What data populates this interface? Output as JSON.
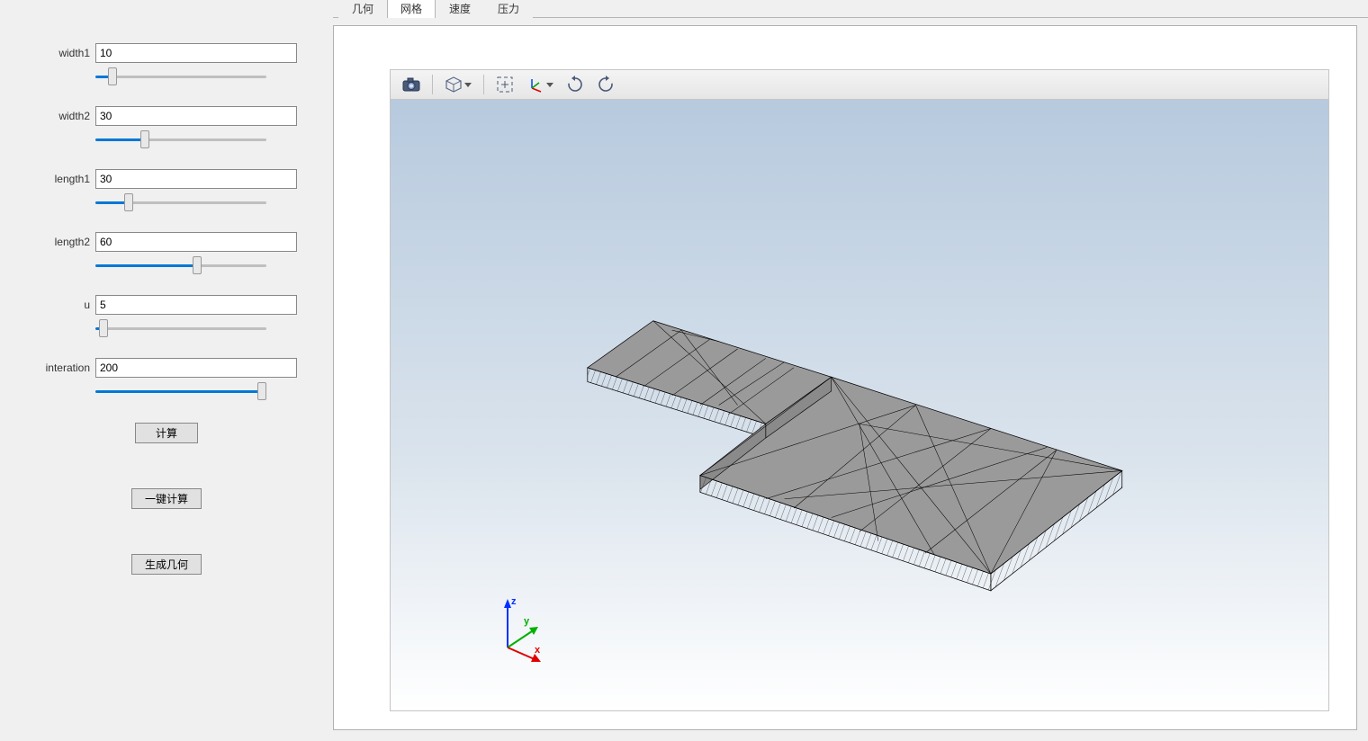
{
  "params": [
    {
      "label": "width1",
      "value": "10",
      "slider_percent": 8
    },
    {
      "label": "width2",
      "value": "30",
      "slider_percent": 28
    },
    {
      "label": "length1",
      "value": "30",
      "slider_percent": 18
    },
    {
      "label": "length2",
      "value": "60",
      "slider_percent": 60
    },
    {
      "label": "u",
      "value": "5",
      "slider_percent": 2
    },
    {
      "label": "interation",
      "value": "200",
      "slider_percent": 100
    }
  ],
  "buttons": {
    "calc": "计算",
    "one_click": "一键计算",
    "gen_geom": "生成几何"
  },
  "tabs": [
    {
      "label": "几何",
      "active": false
    },
    {
      "label": "网格",
      "active": true
    },
    {
      "label": "速度",
      "active": false
    },
    {
      "label": "压力",
      "active": false
    }
  ],
  "toolbar_icons": [
    "camera-icon",
    "cube-view-icon",
    "fit-view-icon",
    "axes-icon",
    "rotate-cw-icon",
    "rotate-ccw-icon"
  ],
  "triad": {
    "x": "x",
    "y": "y",
    "z": "z"
  }
}
